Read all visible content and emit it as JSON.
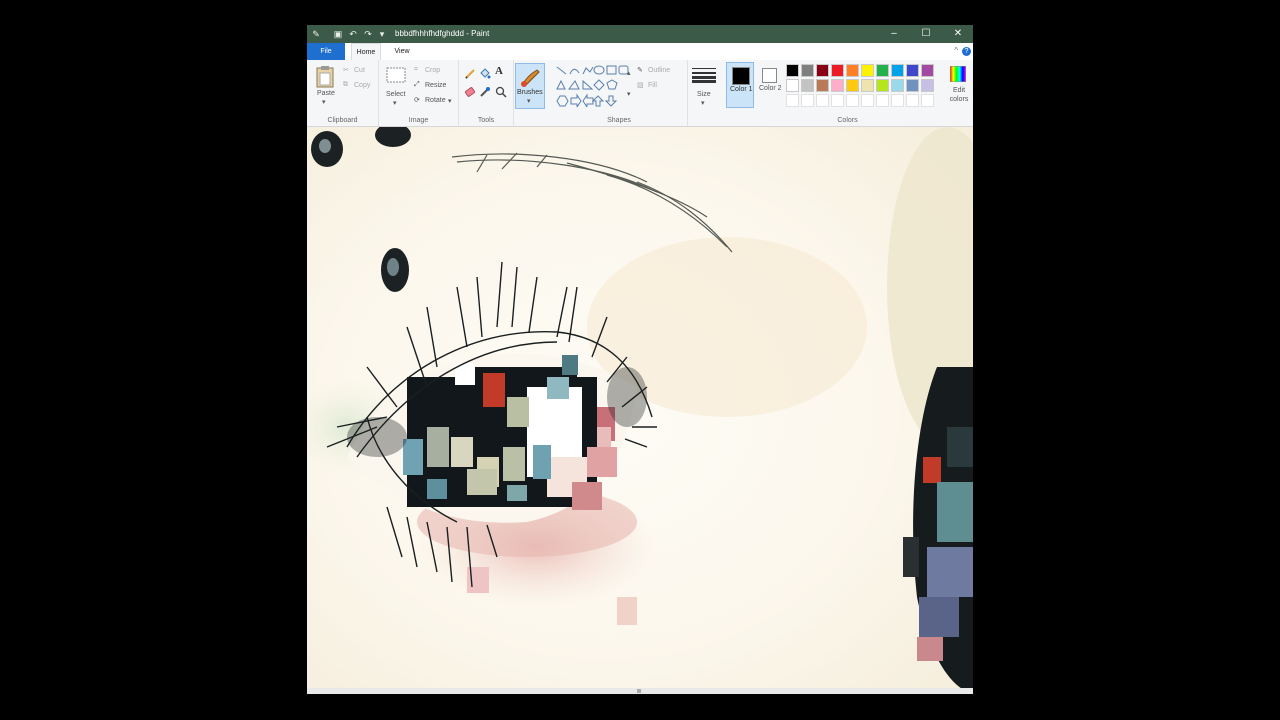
{
  "window": {
    "title": "bbbdfhhhfhdfghddd - Paint",
    "controls": {
      "minimize": "–",
      "maximize": "☐",
      "close": "✕"
    },
    "quick_access": {
      "save": "▣",
      "undo": "↶",
      "redo": "↷",
      "customize": "▾"
    }
  },
  "tabs": {
    "file": "File",
    "home": "Home",
    "view": "View",
    "collapse": "^",
    "help": "?"
  },
  "clipboard": {
    "paste": "Paste",
    "cut": "Cut",
    "copy": "Copy",
    "label": "Clipboard"
  },
  "image": {
    "select": "Select",
    "crop": "Crop",
    "resize": "Resize",
    "rotate": "Rotate",
    "label": "Image"
  },
  "tools": {
    "label": "Tools",
    "text_glyph": "A"
  },
  "brushes": {
    "label": "Brushes"
  },
  "shapes": {
    "outline": "Outline",
    "fill": "Fill",
    "label": "Shapes"
  },
  "size": {
    "label": "Size"
  },
  "colors": {
    "color1": "Color 1",
    "color2": "Color 2",
    "edit": "Edit colors",
    "label": "Colors",
    "color1_value": "#000000",
    "color2_value": "#ffffff",
    "palette_row1": [
      "#000000",
      "#7f7f7f",
      "#880015",
      "#ed1c24",
      "#ff7f27",
      "#fff200",
      "#22b14c",
      "#00a2e8",
      "#3f48cc",
      "#a349a4"
    ],
    "palette_row2": [
      "#ffffff",
      "#c3c3c3",
      "#b97a57",
      "#ffaec9",
      "#ffc90e",
      "#efe4b0",
      "#b5e61d",
      "#99d9ea",
      "#7092be",
      "#c8bfe7"
    ]
  }
}
